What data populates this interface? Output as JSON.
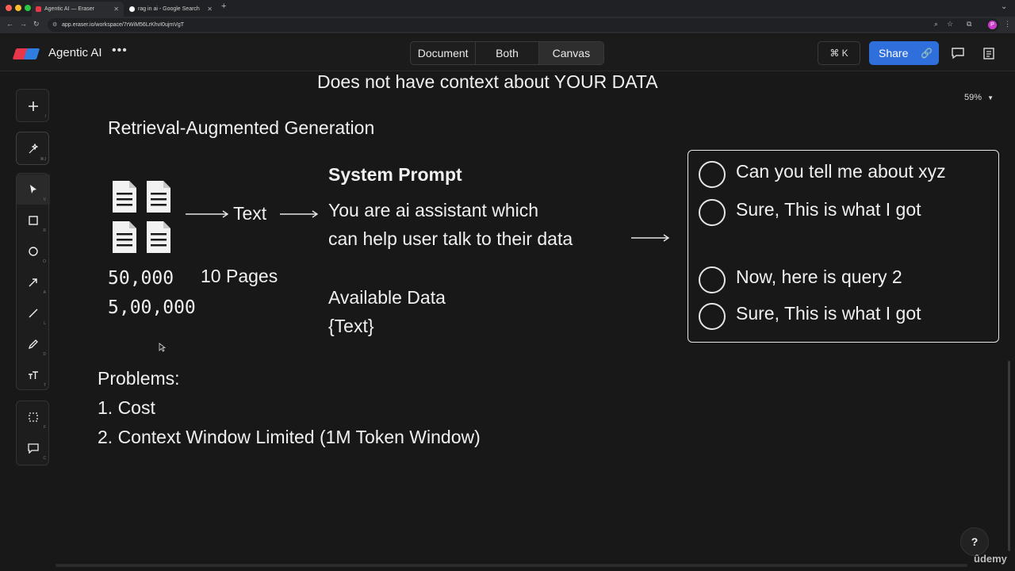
{
  "browser": {
    "tabs": [
      {
        "title": "Agentic AI — Eraser",
        "active": true
      },
      {
        "title": "rag in ai - Google Search",
        "active": false
      }
    ],
    "new_tab": "+",
    "url": "app.eraser.io/workspace/7rWiM56LrKhvI0ujmVgT",
    "profile_initial": "P"
  },
  "header": {
    "app_title": "Agentic AI",
    "more": "•••",
    "view_modes": [
      "Document",
      "Both",
      "Canvas"
    ],
    "selected_view": "Canvas",
    "command_shortcut": "⌘ K",
    "share_label": "Share"
  },
  "toolbar": {
    "tools": [
      {
        "name": "add",
        "key": "/"
      },
      {
        "name": "ai-magic",
        "key": "⌘J"
      },
      {
        "name": "select",
        "key": "V"
      },
      {
        "name": "rectangle",
        "key": "R"
      },
      {
        "name": "circle",
        "key": "O"
      },
      {
        "name": "arrow",
        "key": "A"
      },
      {
        "name": "line",
        "key": "L"
      },
      {
        "name": "pen",
        "key": "D"
      },
      {
        "name": "text",
        "key": "T"
      },
      {
        "name": "frame",
        "key": "F"
      },
      {
        "name": "comment",
        "key": "C"
      }
    ]
  },
  "canvas": {
    "top_heading": "Does not have context about YOUR DATA",
    "title": "Retrieval-Augmented Generation",
    "text_label": "Text",
    "numbers": [
      "50,000",
      "5,00,000"
    ],
    "pages_label": "10 Pages",
    "system_prompt_title": "System Prompt",
    "system_prompt_lines": [
      "You are ai assistant which",
      "can help user talk to their data"
    ],
    "available_data_title": "Available Data",
    "available_data_value": "{Text}",
    "chat": [
      "Can you tell me about xyz",
      "Sure, This is what I got",
      "Now, here is query 2",
      "Sure, This is what I got"
    ],
    "problems_title": "Problems:",
    "problems": [
      "1. Cost",
      "2. Context Window Limited (1M Token Window)"
    ]
  },
  "zoom": "59%",
  "help_label": "?",
  "watermark": "ûdemy",
  "colors": {
    "accent": "#2f6fdc",
    "background": "#181818",
    "logo_red": "#e8364a",
    "logo_blue": "#2f7de1"
  }
}
